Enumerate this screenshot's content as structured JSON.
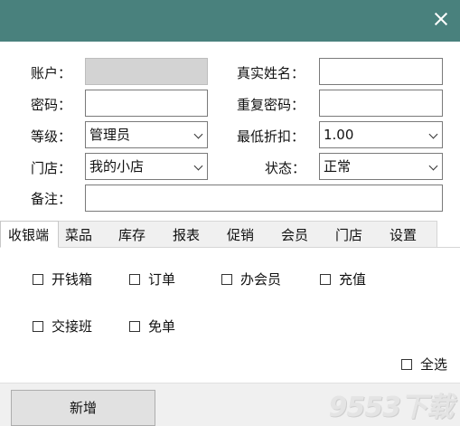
{
  "form": {
    "account_label": "账户：",
    "account_value": "",
    "realname_label": "真实姓名：",
    "realname_value": "",
    "password_label": "密码：",
    "password_value": "",
    "repeat_password_label": "重复密码：",
    "repeat_password_value": "",
    "level_label": "等级：",
    "level_value": "管理员",
    "discount_label": "最低折扣：",
    "discount_value": "1.00",
    "store_label": "门店：",
    "store_value": "我的小店",
    "status_label": "状态：",
    "status_value": "正常",
    "remark_label": "备注：",
    "remark_value": ""
  },
  "tabs": [
    "收银端",
    "菜品",
    "库存",
    "报表",
    "促销",
    "会员",
    "门店",
    "设置"
  ],
  "active_tab": "收银端",
  "permissions": [
    {
      "label": "开钱箱",
      "checked": false
    },
    {
      "label": "订单",
      "checked": false
    },
    {
      "label": "办会员",
      "checked": false
    },
    {
      "label": "充值",
      "checked": false
    },
    {
      "label": "交接班",
      "checked": false
    },
    {
      "label": "免单",
      "checked": false
    }
  ],
  "select_all_label": "全选",
  "footer": {
    "add_button": "新增"
  },
  "watermark": "9553下载"
}
